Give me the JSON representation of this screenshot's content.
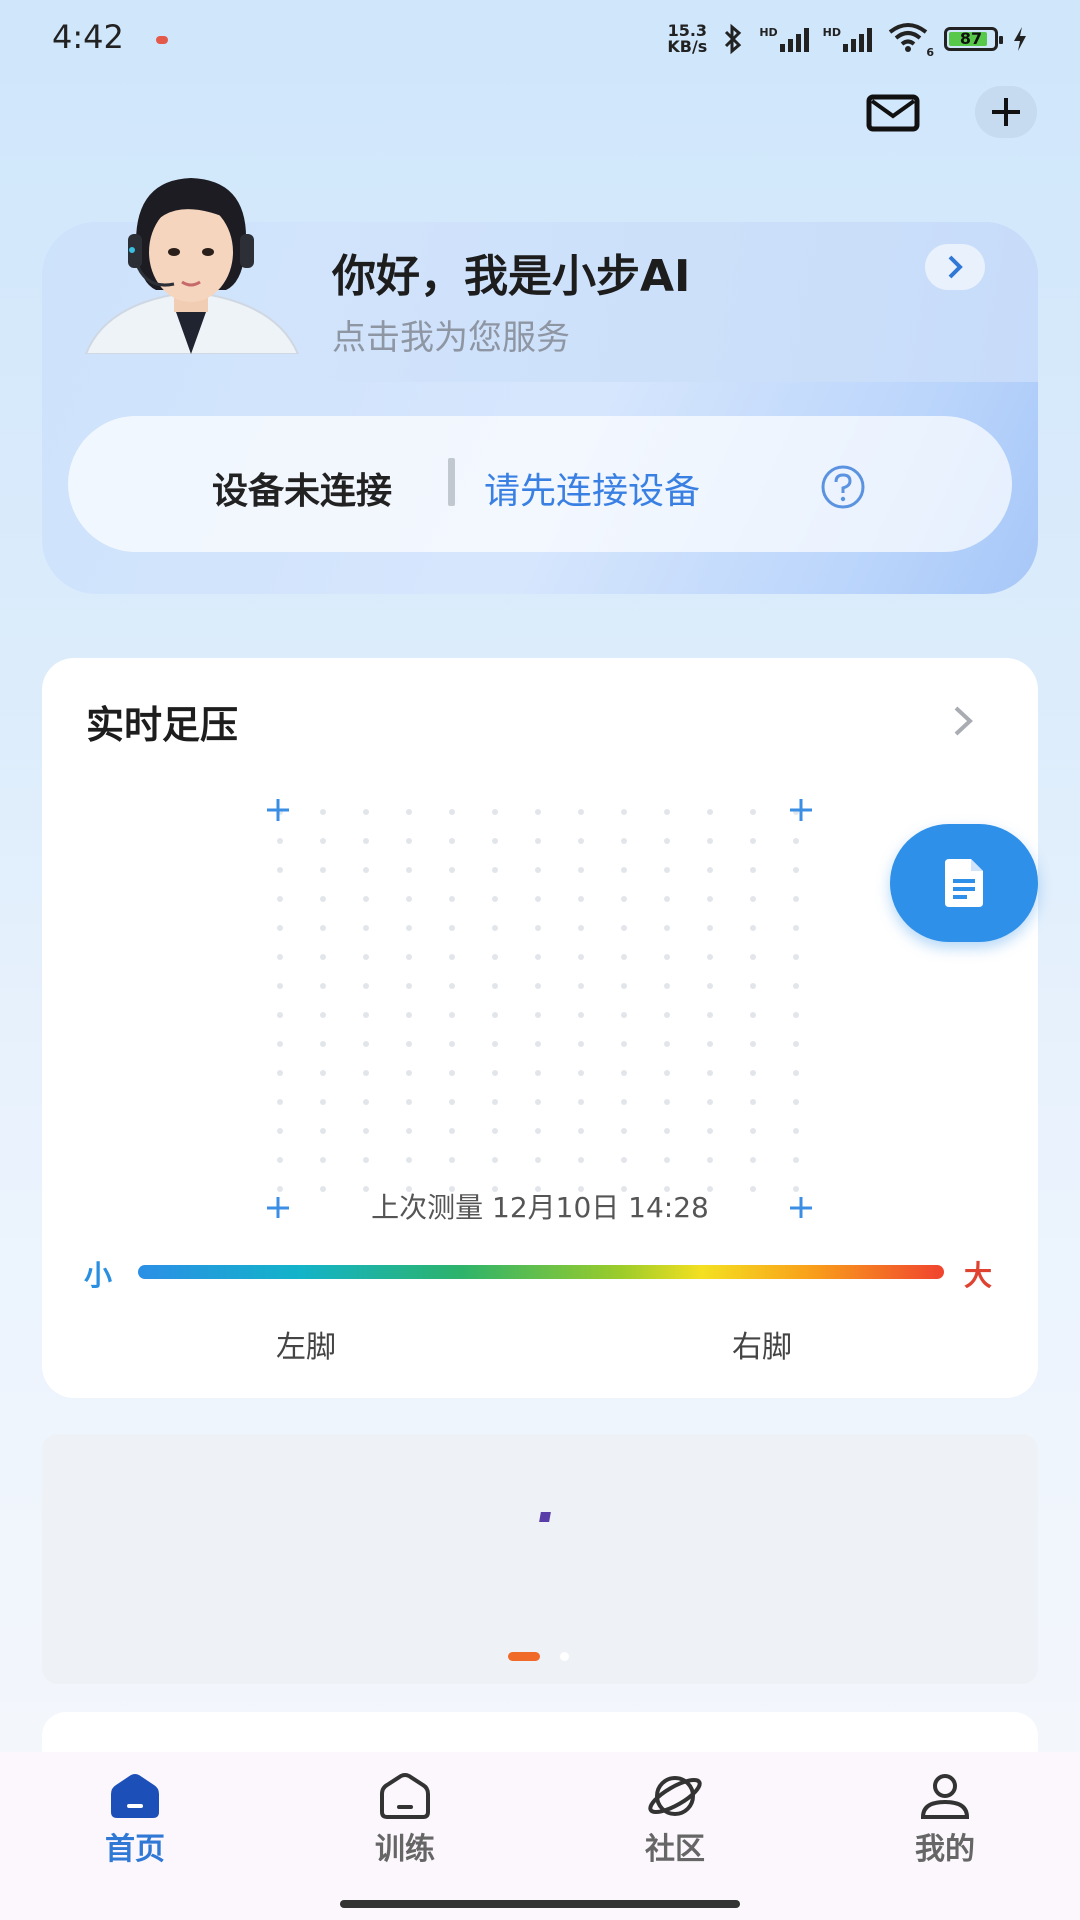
{
  "status_bar": {
    "time": "4:42",
    "net_speed_value": "15.3",
    "net_speed_unit": "KB/s",
    "sim1_label": "HD",
    "sim2_label": "HD",
    "battery": "87",
    "wifi_sub": "6"
  },
  "ai_assistant": {
    "title": "你好，我是小步AI",
    "subtitle": "点击我为您服务"
  },
  "device": {
    "status": "设备未连接",
    "link": "请先连接设备"
  },
  "foot_pressure": {
    "title": "实时足压",
    "last_measured": "上次测量 12月10日 14:28",
    "scale_small": "小",
    "scale_big": "大",
    "left_foot": "左脚",
    "right_foot": "右脚"
  },
  "banner": {
    "active_index": 0,
    "count": 2
  },
  "bottom_nav": {
    "items": [
      {
        "label": "首页",
        "icon": "home-icon",
        "active": true
      },
      {
        "label": "训练",
        "icon": "training-icon",
        "active": false
      },
      {
        "label": "社区",
        "icon": "planet-icon",
        "active": false
      },
      {
        "label": "我的",
        "icon": "profile-icon",
        "active": false
      }
    ]
  },
  "colors": {
    "accent": "#2f78d6",
    "fab": "#2e90e8",
    "link": "#3a80e3",
    "indicator": "#f06a2a"
  }
}
